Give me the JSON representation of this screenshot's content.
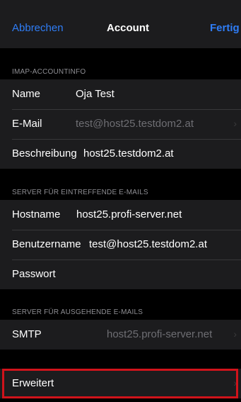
{
  "navbar": {
    "cancel_label": "Abbrechen",
    "title": "Account",
    "done_label": "Fertig"
  },
  "imap_section": {
    "header": "IMAP-ACCOUNTINFO",
    "rows": [
      {
        "label": "Name",
        "value": "Oja Test"
      },
      {
        "label": "E-Mail",
        "value": "test@host25.testdom2.at",
        "chevron": "›"
      },
      {
        "label": "Beschreibung",
        "value": "host25.testdom2.at"
      }
    ]
  },
  "incoming_section": {
    "header": "SERVER FÜR EINTREFFENDE E-MAILS",
    "rows": [
      {
        "label": "Hostname",
        "value": "host25.profi-server.net"
      },
      {
        "label": "Benutzername",
        "value": "test@host25.testdom2.at"
      },
      {
        "label": "Passwort",
        "value": ""
      }
    ]
  },
  "outgoing_section": {
    "header": "SERVER FÜR AUSGEHENDE E-MAILS",
    "rows": [
      {
        "label": "SMTP",
        "value": "host25.profi-server.net",
        "chevron": "›"
      }
    ]
  },
  "advanced_section": {
    "rows": [
      {
        "label": "Erweitert",
        "chevron": "›"
      }
    ]
  },
  "colors": {
    "accent": "#2f7df6",
    "highlight": "#d0131b",
    "background": "#000000",
    "cell": "#1c1c1e"
  }
}
